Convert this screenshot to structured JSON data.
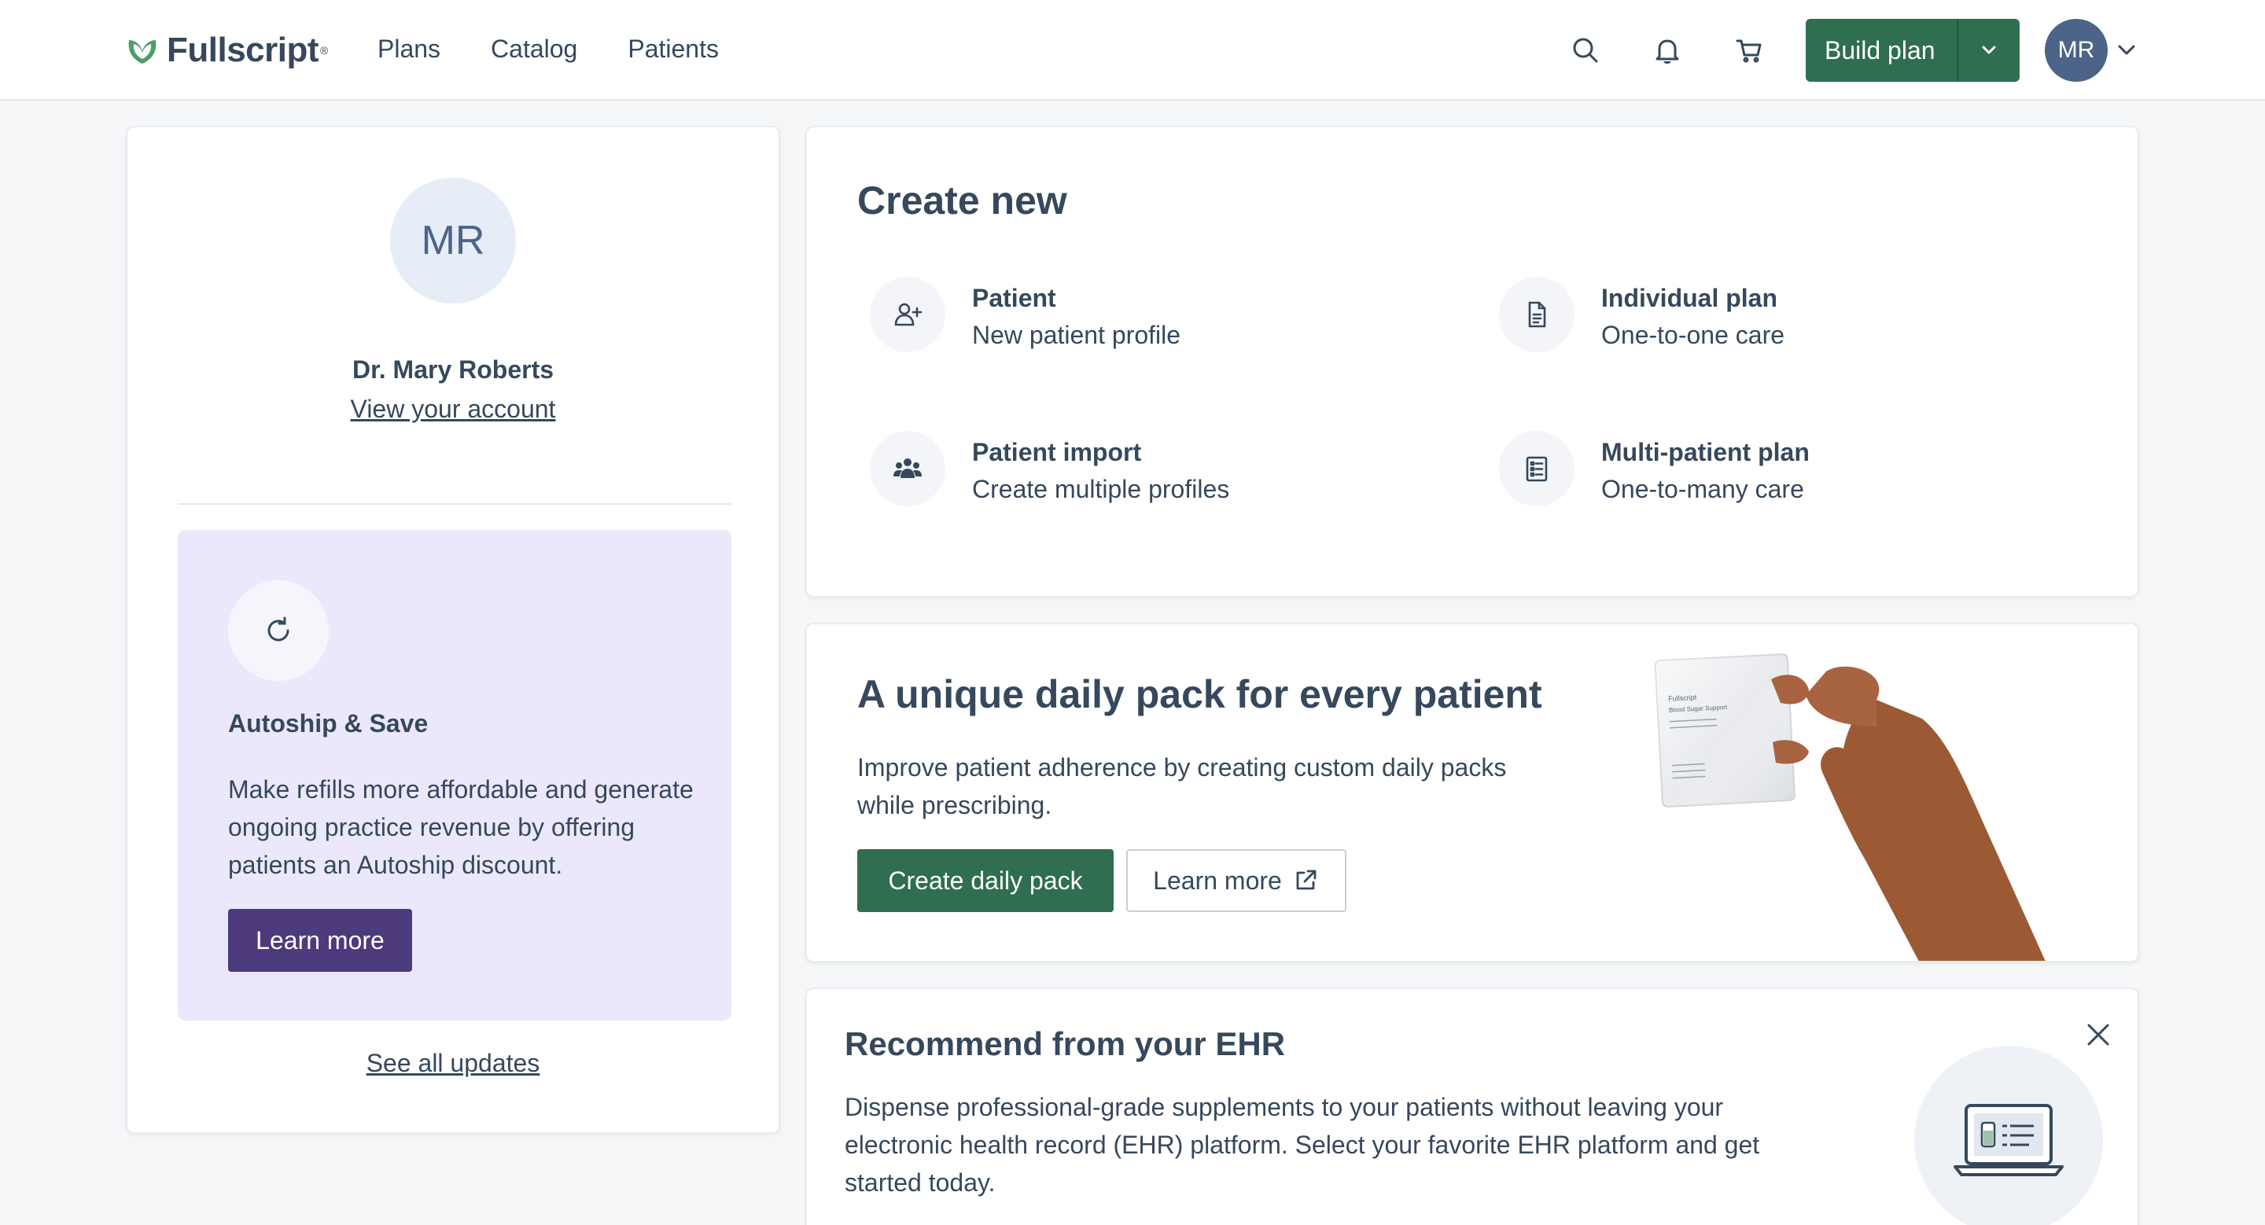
{
  "nav": {
    "brand": "Fullscript",
    "links": [
      "Plans",
      "Catalog",
      "Patients"
    ],
    "icons": [
      "search-icon",
      "bell-icon",
      "cart-icon"
    ],
    "build_plan": "Build plan",
    "user_initials": "MR"
  },
  "profile": {
    "initials": "MR",
    "name": "Dr. Mary Roberts",
    "account_link": "View your account"
  },
  "autoship": {
    "title": "Autoship & Save",
    "body": "Make refills more affordable and generate ongoing practice revenue by offering patients an Autoship discount.",
    "button": "Learn more"
  },
  "updates_link": "See all updates",
  "create_new": {
    "title": "Create new",
    "items": [
      {
        "title": "Patient",
        "subtitle": "New patient profile",
        "icon": "add-user-icon"
      },
      {
        "title": "Individual plan",
        "subtitle": "One-to-one care",
        "icon": "document-icon"
      },
      {
        "title": "Patient import",
        "subtitle": "Create multiple profiles",
        "icon": "users-icon"
      },
      {
        "title": "Multi-patient plan",
        "subtitle": "One-to-many care",
        "icon": "checklist-icon"
      }
    ]
  },
  "daily_pack": {
    "title": "A unique daily pack for every patient",
    "body": "Improve patient adherence by creating custom daily packs while prescribing.",
    "primary_button": "Create daily pack",
    "secondary_button": "Learn more",
    "pack_brand": "Fullscript",
    "pack_label": "Blood Sugar Support"
  },
  "ehr": {
    "title": "Recommend from your EHR",
    "body": "Dispense professional-grade supplements to your patients without leaving your electronic health record (EHR) platform. Select your favorite EHR platform and get started today."
  },
  "colors": {
    "primary_green": "#2f6e4f",
    "autoship_purple": "#4d3a7d",
    "autoship_bg": "#ece8fb",
    "text": "#36485c",
    "page_bg": "#f5f6f8"
  }
}
